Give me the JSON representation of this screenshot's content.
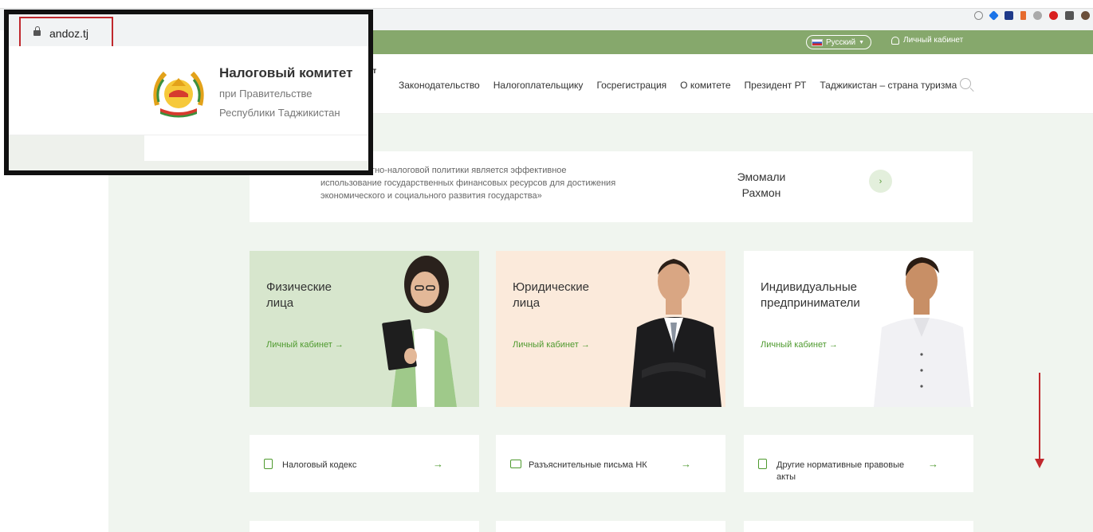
{
  "browser": {
    "url": "andoz.tj"
  },
  "header": {
    "language": "Русский",
    "cabinet": "Личный кабинет"
  },
  "org": {
    "title": "Налоговый комитет",
    "subtitle_line1": "при Правительстве",
    "subtitle_line2": "Республики Таджикистан",
    "nav_fragment_title": "ет",
    "nav_fragment_sub": "н"
  },
  "nav": {
    "items": [
      "Законодательство",
      "Налогоплательщику",
      "Госрегистрация",
      "О комитете",
      "Президент РТ",
      "Таджикистан – страна туризма"
    ]
  },
  "quote": {
    "line1": "елью бюджетно-налоговой политики является эффективное",
    "line2": "использование государственных финансовых ресурсов для достижения",
    "line3": "экономического и социального развития государства»",
    "author_first": "Эмомали",
    "author_last": "Рахмон",
    "next": "›"
  },
  "categories": [
    {
      "title_line1": "Физические",
      "title_line2": "лица",
      "link": "Личный кабинет →"
    },
    {
      "title_line1": "Юридические",
      "title_line2": "лица",
      "link": "Личный кабинет →"
    },
    {
      "title_line1": "Индивидуальные",
      "title_line2": "предприниматели",
      "link": "Личный кабинет →"
    }
  ],
  "docs": [
    {
      "label": "Налоговый кодекс",
      "arrow": "→"
    },
    {
      "label": "Разъяснительные письма НК",
      "arrow": "→"
    },
    {
      "label": "Другие нормативные правовые акты",
      "arrow": "→"
    }
  ],
  "colors": {
    "brand_green": "#86a86c",
    "link_green": "#4e9a2e",
    "annotation_red": "#c0282d"
  }
}
